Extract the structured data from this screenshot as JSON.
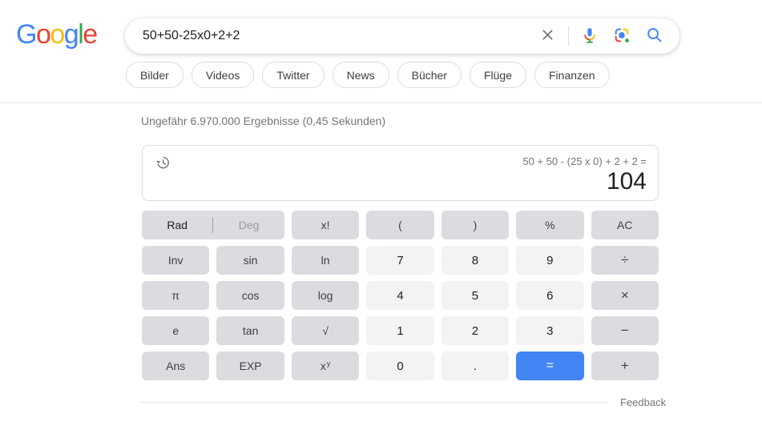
{
  "logo": {
    "letters": [
      {
        "char": "G",
        "color": "#4285F4"
      },
      {
        "char": "o",
        "color": "#EA4335"
      },
      {
        "char": "o",
        "color": "#FBBC05"
      },
      {
        "char": "g",
        "color": "#4285F4"
      },
      {
        "char": "l",
        "color": "#34A853"
      },
      {
        "char": "e",
        "color": "#EA4335"
      }
    ]
  },
  "search": {
    "query": "50+50-25x0+2+2"
  },
  "tabs": [
    {
      "id": "bilder",
      "label": "Bilder"
    },
    {
      "id": "videos",
      "label": "Videos"
    },
    {
      "id": "twitter",
      "label": "Twitter"
    },
    {
      "id": "news",
      "label": "News"
    },
    {
      "id": "buecher",
      "label": "Bücher"
    },
    {
      "id": "fluege",
      "label": "Flüge"
    },
    {
      "id": "finanzen",
      "label": "Finanzen"
    }
  ],
  "stats": "Ungefähr 6.970.000 Ergebnisse (0,45 Sekunden)",
  "calculator": {
    "expression": "50 + 50 - (25 x 0) + 2 + 2 =",
    "result": "104",
    "mode": {
      "rad": "Rad",
      "deg": "Deg"
    },
    "keys": [
      [
        {
          "name": "rad-deg",
          "type": "mode",
          "span": 2
        },
        {
          "name": "factorial",
          "type": "fn",
          "label": "x!"
        },
        {
          "name": "open-paren",
          "type": "fn",
          "label": "("
        },
        {
          "name": "close-paren",
          "type": "fn",
          "label": ")"
        },
        {
          "name": "percent",
          "type": "fn",
          "label": "%"
        },
        {
          "name": "all-clear",
          "type": "fn",
          "label": "AC"
        }
      ],
      [
        {
          "name": "inverse",
          "type": "fn",
          "label": "Inv"
        },
        {
          "name": "sin",
          "type": "fn",
          "label": "sin"
        },
        {
          "name": "ln",
          "type": "fn",
          "label": "ln"
        },
        {
          "name": "7",
          "type": "num",
          "label": "7"
        },
        {
          "name": "8",
          "type": "num",
          "label": "8"
        },
        {
          "name": "9",
          "type": "num",
          "label": "9"
        },
        {
          "name": "divide",
          "type": "op",
          "label": "÷"
        }
      ],
      [
        {
          "name": "pi",
          "type": "fn",
          "label": "π"
        },
        {
          "name": "cos",
          "type": "fn",
          "label": "cos"
        },
        {
          "name": "log",
          "type": "fn",
          "label": "log"
        },
        {
          "name": "4",
          "type": "num",
          "label": "4"
        },
        {
          "name": "5",
          "type": "num",
          "label": "5"
        },
        {
          "name": "6",
          "type": "num",
          "label": "6"
        },
        {
          "name": "multiply",
          "type": "op",
          "label": "×"
        }
      ],
      [
        {
          "name": "e",
          "type": "fn",
          "label": "e"
        },
        {
          "name": "tan",
          "type": "fn",
          "label": "tan"
        },
        {
          "name": "sqrt",
          "type": "fn",
          "label": "√"
        },
        {
          "name": "1",
          "type": "num",
          "label": "1"
        },
        {
          "name": "2",
          "type": "num",
          "label": "2"
        },
        {
          "name": "3",
          "type": "num",
          "label": "3"
        },
        {
          "name": "minus",
          "type": "op",
          "label": "−"
        }
      ],
      [
        {
          "name": "ans",
          "type": "fn",
          "label": "Ans"
        },
        {
          "name": "exp",
          "type": "fn",
          "label": "EXP"
        },
        {
          "name": "power",
          "type": "fn",
          "label": "x",
          "sup": "y"
        },
        {
          "name": "0",
          "type": "num",
          "label": "0"
        },
        {
          "name": "decimal",
          "type": "num",
          "label": "."
        },
        {
          "name": "equals",
          "type": "eq",
          "label": "="
        },
        {
          "name": "plus",
          "type": "op",
          "label": "+"
        }
      ]
    ]
  },
  "feedback": "Feedback",
  "colors": {
    "accent_blue": "#4285f4",
    "key_dark": "#dadce0",
    "key_light": "#f1f3f4",
    "text_dark": "#202124",
    "text_gray": "#70757a"
  }
}
